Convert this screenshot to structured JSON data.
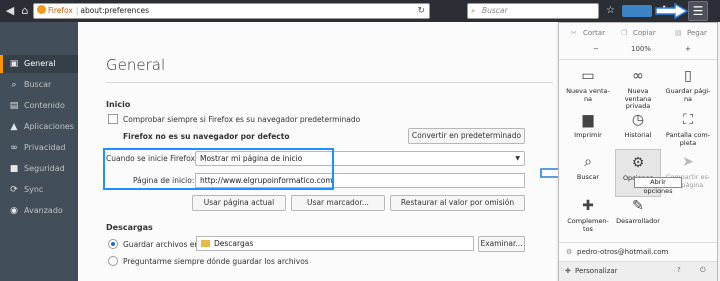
{
  "toolbar": {
    "back_icon": "back-arrow-icon",
    "home_icon": "home-icon",
    "identity_label": "Firefox",
    "url": "about:preferences",
    "search_placeholder": "Buscar"
  },
  "sidebar": {
    "items": [
      {
        "label": "General",
        "icon": "gear-icon",
        "glyph": "▣",
        "active": true
      },
      {
        "label": "Buscar",
        "icon": "search-icon",
        "glyph": "⌕"
      },
      {
        "label": "Contenido",
        "icon": "content-icon",
        "glyph": "▤"
      },
      {
        "label": "Aplicaciones",
        "icon": "applications-icon",
        "glyph": "▲"
      },
      {
        "label": "Privacidad",
        "icon": "privacy-mask-icon",
        "glyph": "∞"
      },
      {
        "label": "Seguridad",
        "icon": "security-lock-icon",
        "glyph": "■"
      },
      {
        "label": "Sync",
        "icon": "sync-icon",
        "glyph": "⟳"
      },
      {
        "label": "Avanzado",
        "icon": "advanced-icon",
        "glyph": "◉"
      }
    ]
  },
  "main": {
    "title": "General",
    "inicio": {
      "heading": "Inicio",
      "check_default": "Comprobar siempre si Firefox es su navegador predeterminado",
      "not_default": "Firefox no es su navegador por defecto",
      "make_default_button": "Convertir en predeterminado",
      "startup_label": "Cuando se inicie Firefox:",
      "startup_value": "Mostrar mi página de inicio",
      "homepage_label": "Página de inicio:",
      "homepage_value": "http://www.elgrupoinformatico.com",
      "use_current": "Usar página actual",
      "use_bookmark": "Usar marcador...",
      "restore_default": "Restaurar al valor por omisión"
    },
    "descargas": {
      "heading": "Descargas",
      "save_to_label": "Guardar archivos en",
      "folder": "Descargas",
      "browse_button": "Examinar...",
      "always_ask": "Preguntarme siempre dónde guardar los archivos"
    }
  },
  "panel": {
    "edit": {
      "cut": "Cortar",
      "copy": "Copiar",
      "paste": "Pegar"
    },
    "zoom": {
      "minus": "−",
      "level": "100%",
      "plus": "+"
    },
    "items": [
      {
        "label": "Nueva venta-\nna",
        "icon": "new-window-icon",
        "glyph": "▭"
      },
      {
        "label": "Nueva ventana\nprivada",
        "icon": "private-mask-icon",
        "glyph": "∞"
      },
      {
        "label": "Guardar pági-\nna",
        "icon": "save-page-icon",
        "glyph": "▯"
      },
      {
        "label": "Imprimir",
        "icon": "print-icon",
        "glyph": "▆"
      },
      {
        "label": "Historial",
        "icon": "history-clock-icon",
        "glyph": "◷"
      },
      {
        "label": "Pantalla com-\npleta",
        "icon": "fullscreen-icon",
        "glyph": "⛶"
      },
      {
        "label": "Buscar",
        "icon": "find-icon",
        "glyph": "⌕"
      },
      {
        "label": "Opciones",
        "icon": "options-gear-icon",
        "glyph": "⚙"
      },
      {
        "label": "Compartir es-\nta página",
        "icon": "share-icon",
        "glyph": "➤"
      },
      {
        "label": "Complemen-\ntos",
        "icon": "addons-puzzle-icon",
        "glyph": "✚"
      },
      {
        "label": "Desarrollador",
        "icon": "developer-wrench-icon",
        "glyph": "✎"
      }
    ],
    "tooltip": "Abrir opciones",
    "account": "pedro-otros@hotmail.com",
    "customize": "Personalizar"
  }
}
